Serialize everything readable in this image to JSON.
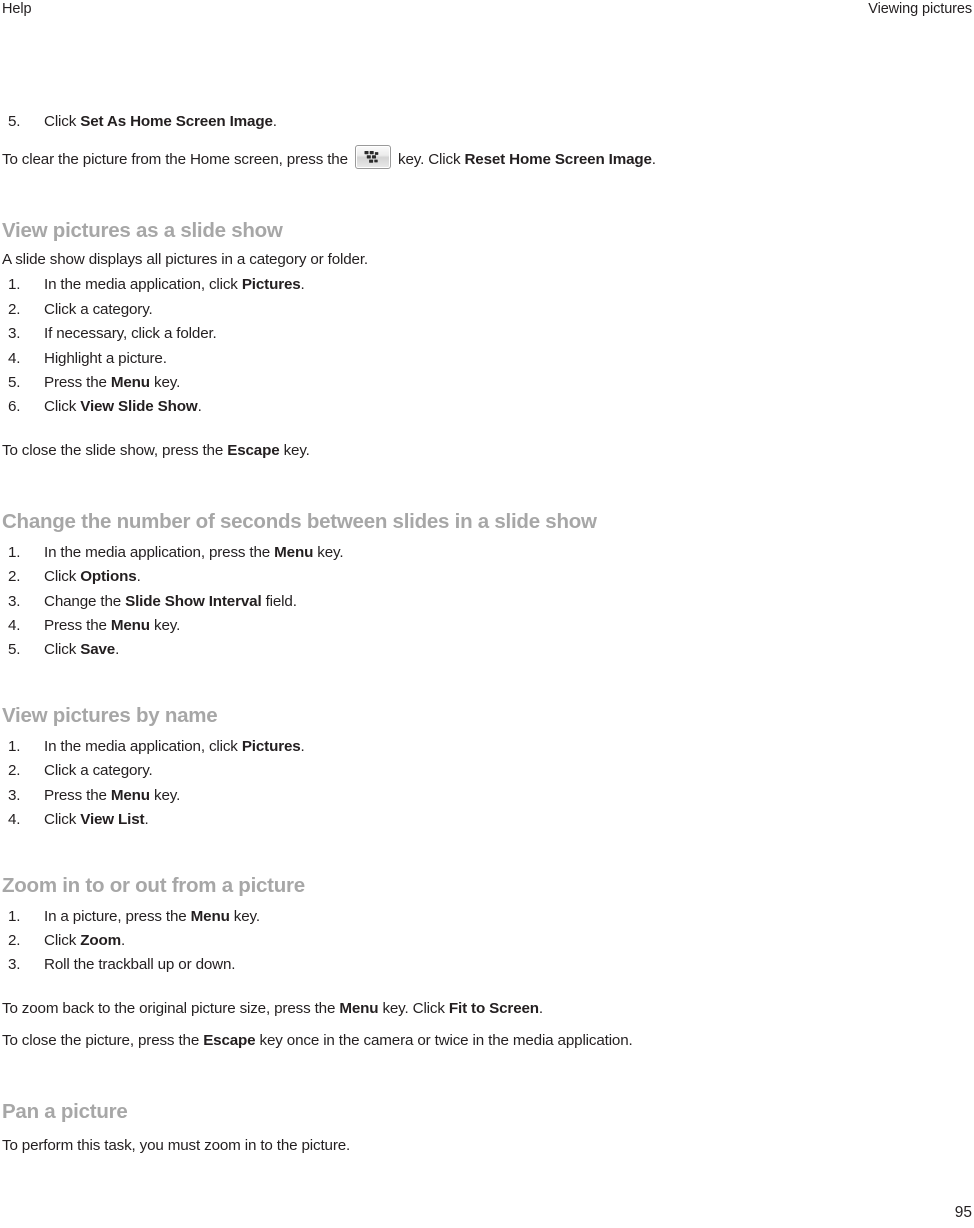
{
  "header": {
    "left": "Help",
    "right": "Viewing pictures"
  },
  "footer": {
    "page_number": "95"
  },
  "icons": {
    "menu_key": "blackberry-menu-key-icon"
  },
  "content": {
    "carryover_step": {
      "number": "5.",
      "text_before": "Click ",
      "bold": "Set As Home Screen Image",
      "text_after": "."
    },
    "carryover_paragraph": {
      "part1": "To clear the picture from the Home screen, press the ",
      "part2": " key. Click ",
      "bold": "Reset Home Screen Image",
      "part3": "."
    },
    "sections": [
      {
        "heading": "View pictures as a slide show",
        "intro": "A slide show displays all pictures in a category or folder.",
        "steps": [
          {
            "pre": "In the media application, click ",
            "bold": "Pictures",
            "post": "."
          },
          {
            "pre": "Click a category.",
            "bold": "",
            "post": ""
          },
          {
            "pre": "If necessary, click a folder.",
            "bold": "",
            "post": ""
          },
          {
            "pre": "Highlight a picture.",
            "bold": "",
            "post": ""
          },
          {
            "pre": "Press the ",
            "bold": "Menu",
            "post": " key."
          },
          {
            "pre": "Click ",
            "bold": "View Slide Show",
            "post": "."
          }
        ],
        "notes": [
          {
            "pre": "To close the slide show, press the ",
            "bold": "Escape",
            "post": " key."
          }
        ]
      },
      {
        "heading": "Change the number of seconds between slides in a slide show",
        "intro": "",
        "steps": [
          {
            "pre": "In the media application, press the ",
            "bold": "Menu",
            "post": " key."
          },
          {
            "pre": "Click ",
            "bold": "Options",
            "post": "."
          },
          {
            "pre": "Change the ",
            "bold": "Slide Show Interval",
            "post": " field."
          },
          {
            "pre": "Press the ",
            "bold": "Menu",
            "post": " key."
          },
          {
            "pre": "Click ",
            "bold": "Save",
            "post": "."
          }
        ],
        "notes": []
      },
      {
        "heading": "View pictures by name",
        "intro": "",
        "steps": [
          {
            "pre": "In the media application, click ",
            "bold": "Pictures",
            "post": "."
          },
          {
            "pre": "Click a category.",
            "bold": "",
            "post": ""
          },
          {
            "pre": "Press the ",
            "bold": "Menu",
            "post": " key."
          },
          {
            "pre": "Click ",
            "bold": "View List",
            "post": "."
          }
        ],
        "notes": []
      },
      {
        "heading": "Zoom in to or out from a picture",
        "intro": "",
        "steps": [
          {
            "pre": "In a picture, press the ",
            "bold": "Menu",
            "post": " key."
          },
          {
            "pre": "Click ",
            "bold": "Zoom",
            "post": "."
          },
          {
            "pre": "Roll the trackball up or down.",
            "bold": "",
            "post": ""
          }
        ],
        "notes": [
          {
            "pre": "To zoom back to the original picture size, press the ",
            "bold": "Menu",
            "post": " key. Click ",
            "bold2": "Fit to Screen",
            "post2": "."
          },
          {
            "pre": "To close the picture, press the ",
            "bold": "Escape",
            "post": " key once in the camera or twice in the media application."
          }
        ]
      },
      {
        "heading": "Pan a picture",
        "intro": "",
        "steps": [],
        "notes": [
          {
            "pre": "To perform this task, you must zoom in to the picture.",
            "bold": "",
            "post": ""
          }
        ]
      }
    ]
  }
}
